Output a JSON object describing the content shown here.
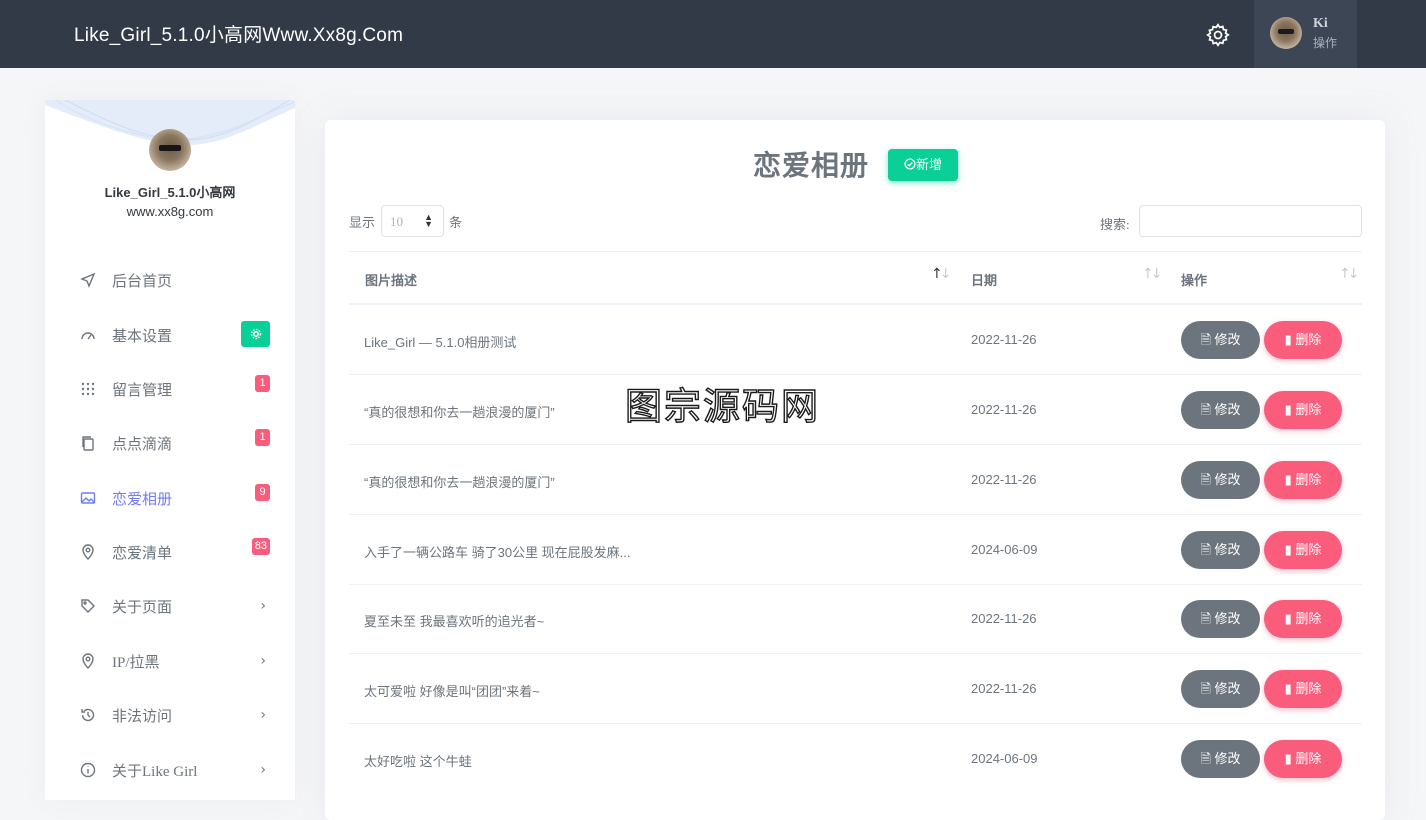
{
  "topbar": {
    "brand": "Like_Girl_5.1.0小高网Www.Xx8g.Com",
    "user_name": "Ki",
    "user_role": "操作"
  },
  "sidebar": {
    "title": "Like_Girl_5.1.0小高网",
    "subtitle": "www.xx8g.com",
    "items": [
      {
        "label": "后台首页",
        "icon": "navigation-arrow-icon"
      },
      {
        "label": "基本设置",
        "icon": "speedometer-icon",
        "badge_icon": "settings-badge-icon"
      },
      {
        "label": "留言管理",
        "icon": "grid-dots-icon",
        "badge": "1"
      },
      {
        "label": "点点滴滴",
        "icon": "copy-icon",
        "badge": "1"
      },
      {
        "label": "恋爱相册",
        "icon": "image-icon",
        "badge": "9",
        "active": true
      },
      {
        "label": "恋爱清单",
        "icon": "map-pin-icon",
        "badge": "83"
      },
      {
        "label": "关于页面",
        "icon": "tags-icon",
        "chevron": "›"
      },
      {
        "label": "IP/拉黑",
        "icon": "location-icon",
        "chevron": "›"
      },
      {
        "label": "非法访问",
        "icon": "history-icon",
        "chevron": "›"
      },
      {
        "label": "关于Like Girl",
        "icon": "info-icon",
        "chevron": "›"
      }
    ]
  },
  "main": {
    "title": "恋爱相册",
    "add_label": "新增",
    "show_label": "显示",
    "page_size": "10",
    "show_suffix": "条",
    "search_label": "搜索:",
    "search_value": "",
    "columns": [
      "图片描述",
      "日期",
      "操作"
    ],
    "edit_label": "修改",
    "delete_label": "删除",
    "rows": [
      {
        "desc": "Like_Girl — 5.1.0相册测试",
        "date": "2022-11-26"
      },
      {
        "desc": "“真的很想和你去一趟浪漫的厦门”",
        "date": "2022-11-26"
      },
      {
        "desc": "“真的很想和你去一趟浪漫的厦门”",
        "date": "2022-11-26"
      },
      {
        "desc": "入手了一辆公路车 骑了30公里 现在屁股发麻...",
        "date": "2024-06-09"
      },
      {
        "desc": "夏至未至 我最喜欢听的追光者~",
        "date": "2022-11-26"
      },
      {
        "desc": "太可爱啦 好像是叫“团团”来着~",
        "date": "2022-11-26"
      },
      {
        "desc": "太好吃啦 这个牛蛙",
        "date": "2024-06-09"
      }
    ]
  },
  "watermark": "图宗源码网",
  "colors": {
    "topbar": "#313a46",
    "accent": "#727cf5",
    "success": "#0acf97",
    "danger": "#fa5c7c",
    "secondary": "#6c757d"
  }
}
